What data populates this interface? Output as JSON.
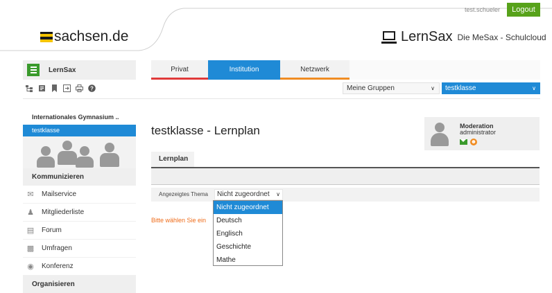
{
  "topbar": {
    "username": "test.schueler",
    "logout_label": "Logout"
  },
  "header": {
    "sachsen_label": "sachsen.de",
    "brand": "LernSax",
    "brand_subtitle": "Die MeSax - Schulcloud"
  },
  "nav": {
    "app_label": "LernSax",
    "tabs": [
      {
        "label": "Privat",
        "color": "#e03a3a"
      },
      {
        "label": "Institution",
        "color": "#1f8ad6",
        "active": true
      },
      {
        "label": "Netzwerk",
        "color": "#f08c22"
      }
    ]
  },
  "toolbar": {
    "icons": [
      "sitemap-icon",
      "notes-icon",
      "bookmark-icon",
      "export-icon",
      "print-icon",
      "help-icon"
    ],
    "group_select": "Meine Gruppen",
    "class_select": "testklasse"
  },
  "sidebar": {
    "institution": "Internationales Gymnasium ..",
    "active_group": "testklasse",
    "section_communicate": "Kommunizieren",
    "items": [
      {
        "label": "Mailservice",
        "icon": "mail-icon"
      },
      {
        "label": "Mitgliederliste",
        "icon": "members-icon"
      },
      {
        "label": "Forum",
        "icon": "forum-icon"
      },
      {
        "label": "Umfragen",
        "icon": "chart-icon"
      },
      {
        "label": "Konferenz",
        "icon": "conference-icon"
      }
    ],
    "section_organize": "Organisieren"
  },
  "main": {
    "title": "testklasse - Lernplan",
    "subtab": "Lernplan",
    "filter_label": "Angezeigtes Thema",
    "theme_value": "Nicht zugeordnet",
    "hint": "Bitte wählen Sie ein"
  },
  "moderation": {
    "title": "Moderation",
    "name": "administrator"
  },
  "dropdown": {
    "options": [
      "Nicht zugeordnet",
      "Deutsch",
      "Englisch",
      "Geschichte",
      "Mathe"
    ],
    "selected_index": 0
  },
  "colors": {
    "accent": "#1f8ad6",
    "green": "#57a21a",
    "orange": "#ef6c1a"
  }
}
